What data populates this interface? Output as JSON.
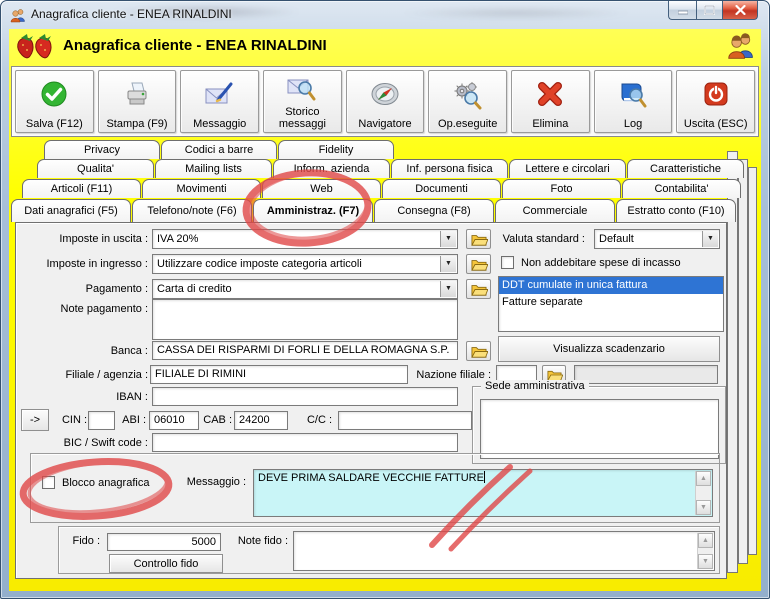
{
  "window": {
    "title": "Anagrafica cliente - ENEA RINALDINI"
  },
  "header": {
    "title": "Anagrafica cliente - ENEA RINALDINI"
  },
  "toolbar": {
    "buttons": [
      {
        "label": "Salva (F12)"
      },
      {
        "label": "Stampa (F9)"
      },
      {
        "label": "Messaggio"
      },
      {
        "label": "Storico messaggi"
      },
      {
        "label": "Navigatore"
      },
      {
        "label": "Op.eseguite"
      },
      {
        "label": "Elimina"
      },
      {
        "label": "Log"
      },
      {
        "label": "Uscita (ESC)"
      }
    ]
  },
  "tabs": {
    "row1": [
      "Privacy",
      "Codici a barre",
      "Fidelity"
    ],
    "row2": [
      "Qualita'",
      "Mailing lists",
      "Inform. azienda",
      "Inf. persona fisica",
      "Lettere e circolari",
      "Caratteristiche"
    ],
    "row3": [
      "Articoli (F11)",
      "Movimenti",
      "Web",
      "Documenti",
      "Foto",
      "Contabilita'"
    ],
    "row4": [
      "Dati anagrafici (F5)",
      "Telefono/note (F6)",
      "Amministraz. (F7)",
      "Consegna (F8)",
      "Commerciale",
      "Estratto conto (F10)"
    ],
    "active": "Amministraz. (F7)"
  },
  "form": {
    "imposte_uscita": {
      "label": "Imposte in uscita :",
      "value": "IVA 20%"
    },
    "imposte_ingresso": {
      "label": "Imposte in ingresso :",
      "value": "Utilizzare codice imposte categoria articoli"
    },
    "pagamento": {
      "label": "Pagamento :",
      "value": "Carta di credito"
    },
    "note_pagamento": {
      "label": "Note pagamento :",
      "value": ""
    },
    "banca": {
      "label": "Banca :",
      "value": "CASSA DEI RISPARMI DI FORLI  E  DELLA ROMAGNA S.P."
    },
    "filiale": {
      "label": "Filiale / agenzia :",
      "value": "FILIALE DI RIMINI"
    },
    "nazione": {
      "label": "Nazione filiale :",
      "value": ""
    },
    "iban": {
      "label": "IBAN :",
      "value": ""
    },
    "arrow_button": "->",
    "cin": {
      "label": "CIN :",
      "value": ""
    },
    "abi": {
      "label": "ABI :",
      "value": "06010"
    },
    "cab": {
      "label": "CAB :",
      "value": "24200"
    },
    "cc": {
      "label": "C/C :",
      "value": ""
    },
    "bic": {
      "label": "BIC / Swift code :",
      "value": ""
    },
    "valuta": {
      "label": "Valuta standard :",
      "value": "Default"
    },
    "spese_checkbox_label": "Non addebitare spese di incasso",
    "fatturazione_options": [
      "DDT cumulate in unica fattura",
      "Fatture separate"
    ],
    "fatturazione_selected": "DDT cumulate in unica fattura",
    "visualizza_button": "Visualizza scadenzario",
    "sede_group_label": "Sede amministrativa",
    "blocco_checkbox_label": "Blocco anagrafica",
    "messaggio": {
      "label": "Messaggio :",
      "value": "DEVE PRIMA SALDARE VECCHIE FATTURE"
    },
    "fido": {
      "label": "Fido :",
      "value": "5000"
    },
    "note_fido": {
      "label": "Note fido :",
      "value": ""
    },
    "controllo_button": "Controllo fido"
  },
  "icons": {
    "dropdown": "▼",
    "scroll_up": "▲",
    "scroll_down": "▼"
  },
  "colors": {
    "selection_blue": "#2e74d4",
    "message_bg": "#c9f5f7",
    "annotation_red": "#e04848",
    "frame_yellow": "#ffff00"
  }
}
